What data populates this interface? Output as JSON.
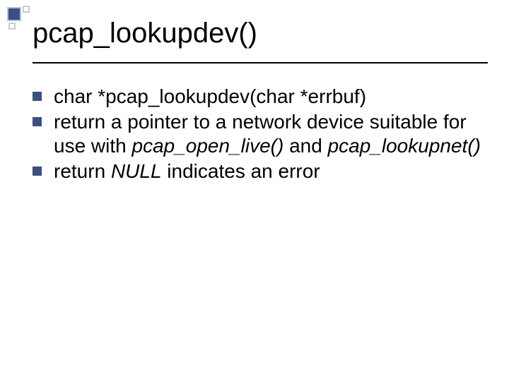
{
  "title": "pcap_lookupdev()",
  "bullets": [
    {
      "parts": [
        {
          "t": "char *pcap_lookupdev(char *errbuf)",
          "i": false
        }
      ]
    },
    {
      "parts": [
        {
          "t": "return a pointer to a network device suitable for use with ",
          "i": false
        },
        {
          "t": "pcap_open_live()",
          "i": true
        },
        {
          "t": " and ",
          "i": false
        },
        {
          "t": "pcap_lookupnet()",
          "i": true
        }
      ]
    },
    {
      "parts": [
        {
          "t": "return ",
          "i": false
        },
        {
          "t": "NULL",
          "i": true
        },
        {
          "t": " indicates an error",
          "i": false
        }
      ]
    }
  ],
  "icons": {
    "square_bullet": "square-bullet-icon",
    "corner_decor": "corner-decor-icon"
  }
}
